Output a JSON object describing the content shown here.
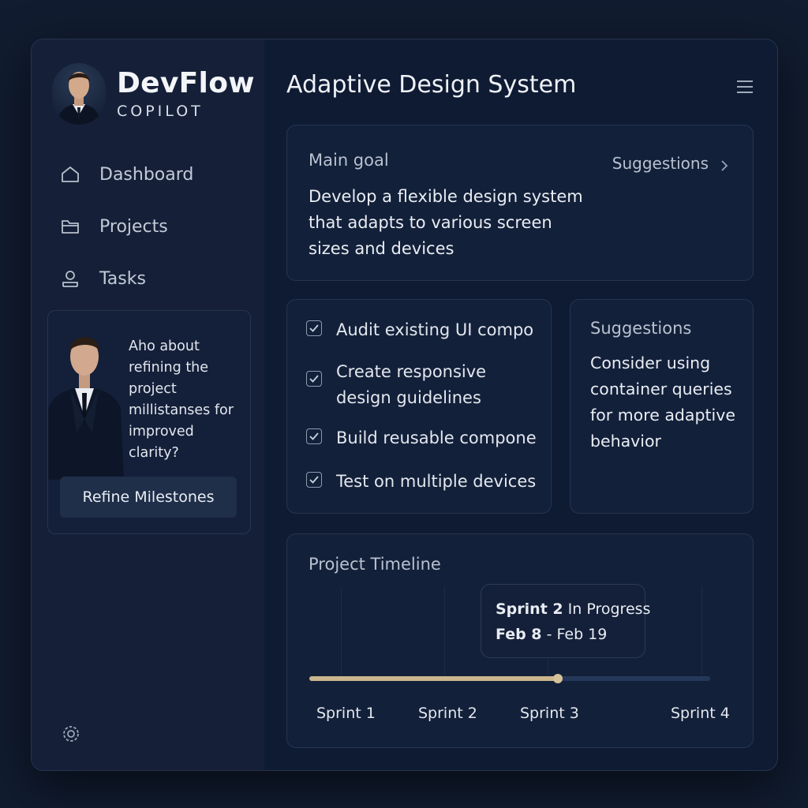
{
  "brand": {
    "name": "DevFlow",
    "subtitle": "COPILOT"
  },
  "nav": [
    {
      "label": "Dashboard",
      "icon": "home-icon"
    },
    {
      "label": "Projects",
      "icon": "folder-icon"
    },
    {
      "label": "Tasks",
      "icon": "user-icon"
    }
  ],
  "assistant": {
    "message": "Aho about refining the project millistanses for improved clarity?",
    "button_label": "Refine Milestones"
  },
  "page": {
    "title": "Adaptive Design System"
  },
  "goal": {
    "label": "Main goal",
    "text": "Develop a flexible design system that adapts to various screen sizes and devices",
    "suggestions_link": "Suggestions"
  },
  "tasks": [
    {
      "label": "Audit existing UI compo",
      "checked": true
    },
    {
      "label": "Create responsive design guidelines",
      "checked": true
    },
    {
      "label": "Build reusable compone",
      "checked": true
    },
    {
      "label": "Test on multiple devices",
      "checked": true
    }
  ],
  "suggestions": {
    "title": "Suggestions",
    "text": "Consider using container queries for more adaptive behavior"
  },
  "timeline": {
    "title": "Project Timeline",
    "sprints": [
      "Sprint 1",
      "Sprint 2",
      "Sprint 3",
      "Sprint 4"
    ],
    "progress": 0.62,
    "tooltip": {
      "sprint": "Sprint 2",
      "status": "In Progress",
      "start": "Feb 8",
      "separator": "-",
      "end": "Feb 19"
    }
  },
  "colors": {
    "background": "#111c30",
    "panel": "#0f1b33",
    "sidebar": "#152038",
    "accent": "#cbb68d",
    "track": "#25385a"
  }
}
